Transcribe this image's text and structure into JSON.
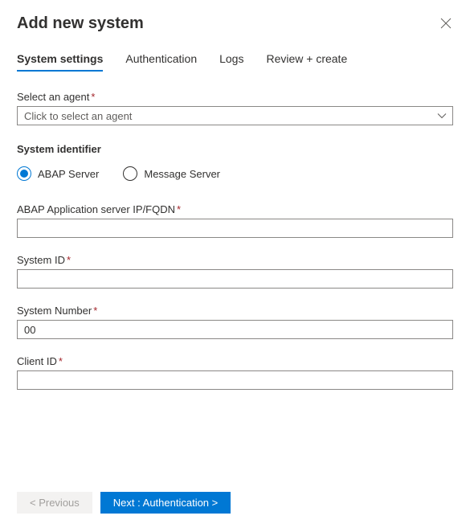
{
  "header": {
    "title": "Add new system"
  },
  "tabs": [
    {
      "label": "System settings",
      "active": true
    },
    {
      "label": "Authentication",
      "active": false
    },
    {
      "label": "Logs",
      "active": false
    },
    {
      "label": "Review + create",
      "active": false
    }
  ],
  "form": {
    "select_agent": {
      "label": "Select an agent",
      "placeholder": "Click to select an agent"
    },
    "system_identifier": {
      "heading": "System identifier",
      "options": [
        {
          "label": "ABAP Server",
          "checked": true
        },
        {
          "label": "Message Server",
          "checked": false
        }
      ]
    },
    "abap_server": {
      "label": "ABAP Application server IP/FQDN",
      "value": ""
    },
    "system_id": {
      "label": "System ID",
      "value": ""
    },
    "system_number": {
      "label": "System Number",
      "value": "00"
    },
    "client_id": {
      "label": "Client ID",
      "value": ""
    }
  },
  "footer": {
    "previous": "< Previous",
    "next": "Next : Authentication >"
  },
  "required_marker": "*"
}
